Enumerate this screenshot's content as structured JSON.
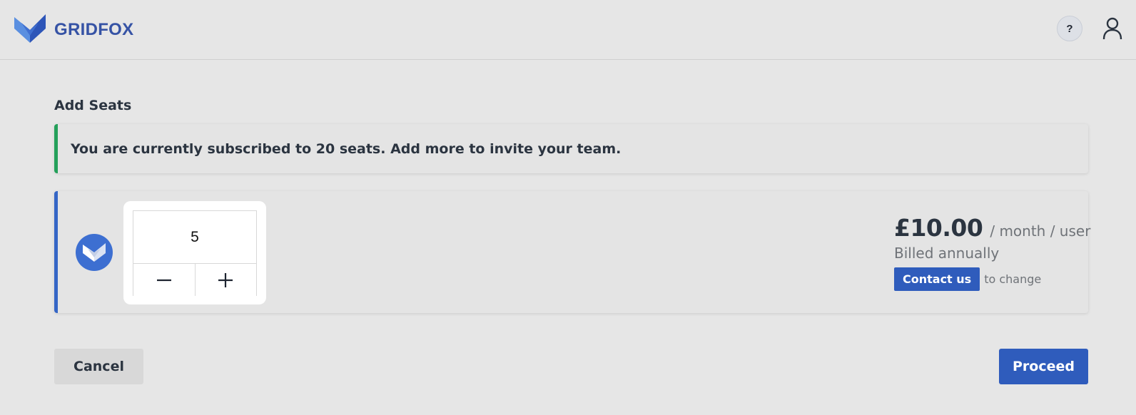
{
  "header": {
    "brand": "GRIDFOX",
    "help_label": "?",
    "logo_icon": "gridfox-fox-logo",
    "user_icon": "user-icon"
  },
  "main": {
    "title": "Add Seats",
    "info_message": "You are currently subscribed to 20 seats. Add more to invite your team.",
    "seats": {
      "quantity": "5",
      "decrement_icon": "minus-icon",
      "increment_icon": "plus-icon"
    },
    "pricing": {
      "amount": "£10.00",
      "unit": "/ month / user",
      "billing": "Billed annually",
      "contact_label": "Contact us",
      "contact_suffix": "to change"
    }
  },
  "actions": {
    "cancel_label": "Cancel",
    "proceed_label": "Proceed"
  },
  "colors": {
    "brand": "#3653a5",
    "primary": "#2f5cbc",
    "success_accent": "#24a05a",
    "card_accent": "#3566c6"
  }
}
